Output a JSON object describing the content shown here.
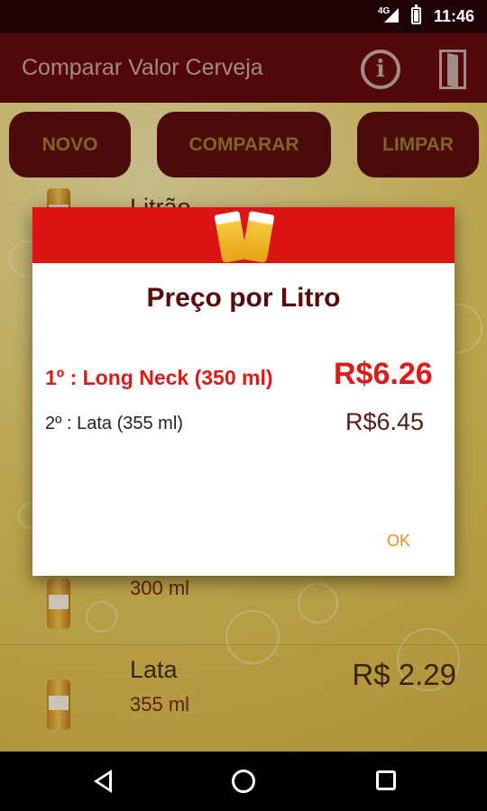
{
  "status_bar": {
    "network": "4G",
    "time": "11:46"
  },
  "app": {
    "title": "Comparar Valor Cerveja",
    "buttons": {
      "novo": "NOVO",
      "comparar": "COMPARAR",
      "limpar": "LIMPAR"
    },
    "list": [
      {
        "name": "Litrão"
      },
      {
        "volume": "300 ml"
      },
      {
        "name": "Lata",
        "volume": "355 ml",
        "price": "R$ 2.29"
      }
    ]
  },
  "dialog": {
    "title": "Preço por Litro",
    "results": [
      {
        "rank": "1º :  Long Neck (350 ml)",
        "price": "R$6.26"
      },
      {
        "rank": "2º :  Lata (355 ml)",
        "price": "R$6.45"
      }
    ],
    "ok_label": "OK"
  },
  "colors": {
    "app_bar": "#640a0a",
    "dialog_header": "#dc1414",
    "highlight": "#e01919",
    "ok": "#f08c1a"
  },
  "icons": [
    "info-icon",
    "exit-door-icon",
    "beer-glasses-icon",
    "nav-back-icon",
    "nav-home-icon",
    "nav-recent-icon"
  ]
}
